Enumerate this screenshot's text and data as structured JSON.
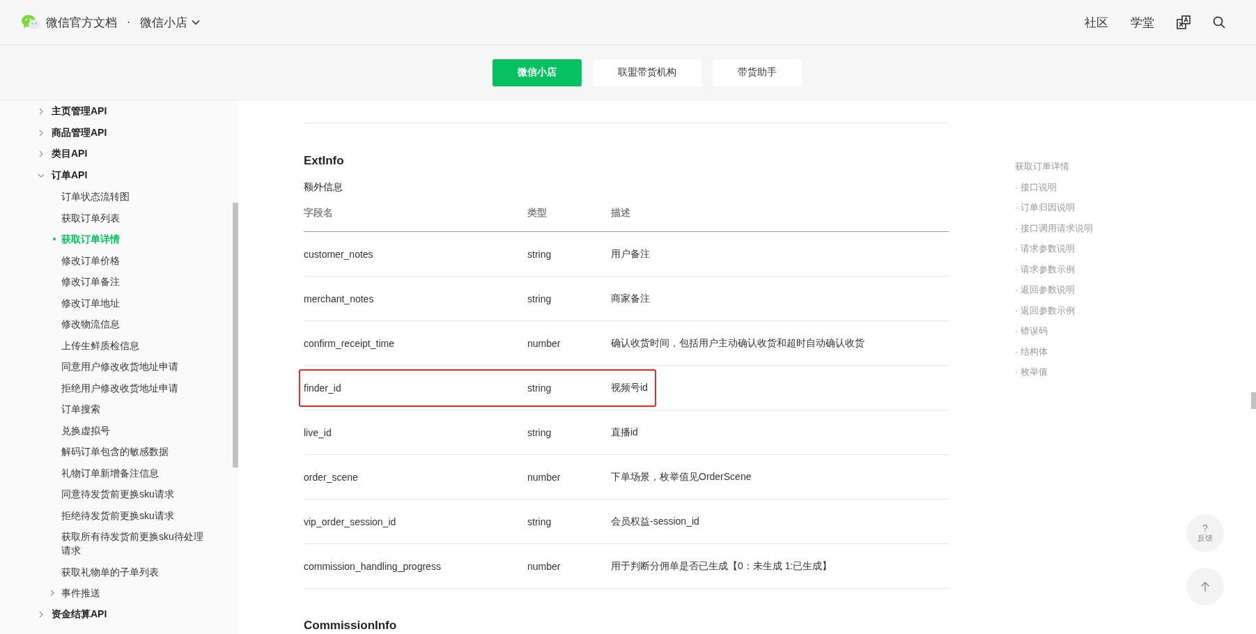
{
  "header": {
    "site": "微信官方文档",
    "separator": "·",
    "product": "微信小店",
    "nav": [
      "社区",
      "学堂"
    ]
  },
  "tabs": [
    {
      "label": "微信小店",
      "selected": true
    },
    {
      "label": "联盟带货机构",
      "selected": false
    },
    {
      "label": "带货助手",
      "selected": false
    }
  ],
  "sidebar": {
    "items": [
      {
        "label": "主页管理API",
        "expanded": false,
        "selected": false
      },
      {
        "label": "商品管理API",
        "expanded": false,
        "selected": false
      },
      {
        "label": "类目API",
        "expanded": false,
        "selected": false
      },
      {
        "label": "订单API",
        "expanded": true,
        "selected": false,
        "children": [
          {
            "label": "订单状态流转图",
            "selected": false
          },
          {
            "label": "获取订单列表",
            "selected": false
          },
          {
            "label": "获取订单详情",
            "selected": true
          },
          {
            "label": "修改订单价格",
            "selected": false
          },
          {
            "label": "修改订单备注",
            "selected": false
          },
          {
            "label": "修改订单地址",
            "selected": false
          },
          {
            "label": "修改物流信息",
            "selected": false
          },
          {
            "label": "上传生鲜质检信息",
            "selected": false
          },
          {
            "label": "同意用户修改收货地址申请",
            "selected": false
          },
          {
            "label": "拒绝用户修改收货地址申请",
            "selected": false
          },
          {
            "label": "订单搜索",
            "selected": false
          },
          {
            "label": "兑换虚拟号",
            "selected": false
          },
          {
            "label": "解码订单包含的敏感数据",
            "selected": false
          },
          {
            "label": "礼物订单新增备注信息",
            "selected": false
          },
          {
            "label": "同意待发货前更换sku请求",
            "selected": false
          },
          {
            "label": "拒绝待发货前更换sku请求",
            "selected": false
          },
          {
            "label": "获取所有待发货前更换sku待处理请求",
            "selected": false
          },
          {
            "label": "获取礼物单的子单列表",
            "selected": false
          },
          {
            "label": "事件推送",
            "expanded": false,
            "selected": false
          }
        ]
      },
      {
        "label": "资金结算API",
        "expanded": false,
        "selected": false
      }
    ]
  },
  "content": {
    "section": {
      "title": "ExtInfo",
      "subtitle": "额外信息",
      "columns": [
        "字段名",
        "类型",
        "描述"
      ],
      "rows": [
        {
          "name": "customer_notes",
          "type": "string",
          "description": "用户备注",
          "highlighted": false
        },
        {
          "name": "merchant_notes",
          "type": "string",
          "description": "商家备注",
          "highlighted": false
        },
        {
          "name": "confirm_receipt_time",
          "type": "number",
          "description": "确认收货时间，包括用户主动确认收货和超时自动确认收货",
          "highlighted": false
        },
        {
          "name": "finder_id",
          "type": "string",
          "description": "视频号id",
          "highlighted": true
        },
        {
          "name": "live_id",
          "type": "string",
          "description": "直播id",
          "highlighted": false
        },
        {
          "name": "order_scene",
          "type": "number",
          "description": "下单场景，枚举值见OrderScene",
          "highlighted": false
        },
        {
          "name": "vip_order_session_id",
          "type": "string",
          "description": "会员权益-session_id",
          "highlighted": false
        },
        {
          "name": "commission_handling_progress",
          "type": "number",
          "description": "用于判断分佣单是否已生成【0：未生成 1:已生成】",
          "highlighted": false
        }
      ]
    },
    "next_section": {
      "title": "CommissionInfo"
    }
  },
  "toc": {
    "title": "获取订单详情",
    "bullet": "·",
    "items": [
      "接口说明",
      "订单归因说明",
      "接口调用请求说明",
      "请求参数说明",
      "请求参数示例",
      "返回参数说明",
      "返回参数示例",
      "错误码",
      "结构体",
      "枚举值"
    ]
  },
  "feedback": {
    "symbol": "?",
    "label": "反馈"
  }
}
